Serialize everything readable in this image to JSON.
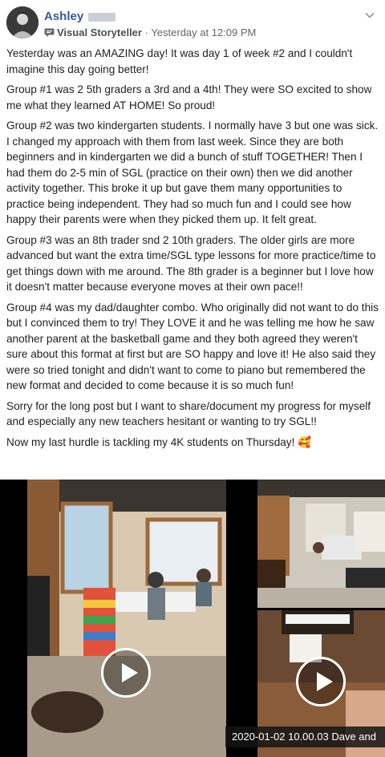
{
  "post": {
    "author_name": "Ashley",
    "badge": "Visual Storyteller",
    "separator": " · ",
    "time": "Yesterday at 12:09 PM",
    "paragraphs": [
      "Yesterday was an AMAZING day! It was day 1 of week #2 and I couldn't imagine this day going better!",
      "Group #1 was 2 5th graders a 3rd and a 4th! They were SO excited to show me what they learned AT HOME! So proud!",
      "Group #2 was two kindergarten students. I normally have 3 but one was sick. I changed my approach with them from last week. Since they are both beginners and in kindergarten we did a bunch of stuff TOGETHER! Then I had them do 2-5 min of SGL (practice on their own) then we did another activity together. This broke it up but gave them many opportunities to practice being independent. They had so much fun and I could see how happy their parents were when they picked them up. It felt great.",
      "Group #3 was an 8th trader snd 2 10th graders. The older girls are more advanced but want the extra time/SGL type lessons for more practice/time to get things down with me around. The 8th grader is a beginner but I love how it doesn't matter because everyone moves at their own pace!!",
      "Group #4 was my dad/daughter combo. Who originally did not want to do this but I convinced them to try! They LOVE it and he was telling me how he saw another parent at the basketball game and they both agreed they weren't sure about this format at first but are SO happy and love it! He also said they were so tried tonight and didn't want to come to piano but remembered the new format and decided to come because it is so much fun!",
      "Sorry for the long post but I want to share/document my progress for myself and especially any new teachers hesitant or wanting to try SGL!!",
      "Now my last hurdle is tackling my 4K students on Thursday! 🥰"
    ]
  },
  "media": {
    "video_caption": "2020-01-02 10.00.03 Dave and"
  },
  "icons": {
    "badge_icon": "storyteller-icon",
    "menu_icon": "chevron-down-icon",
    "play_icon": "play-icon"
  }
}
